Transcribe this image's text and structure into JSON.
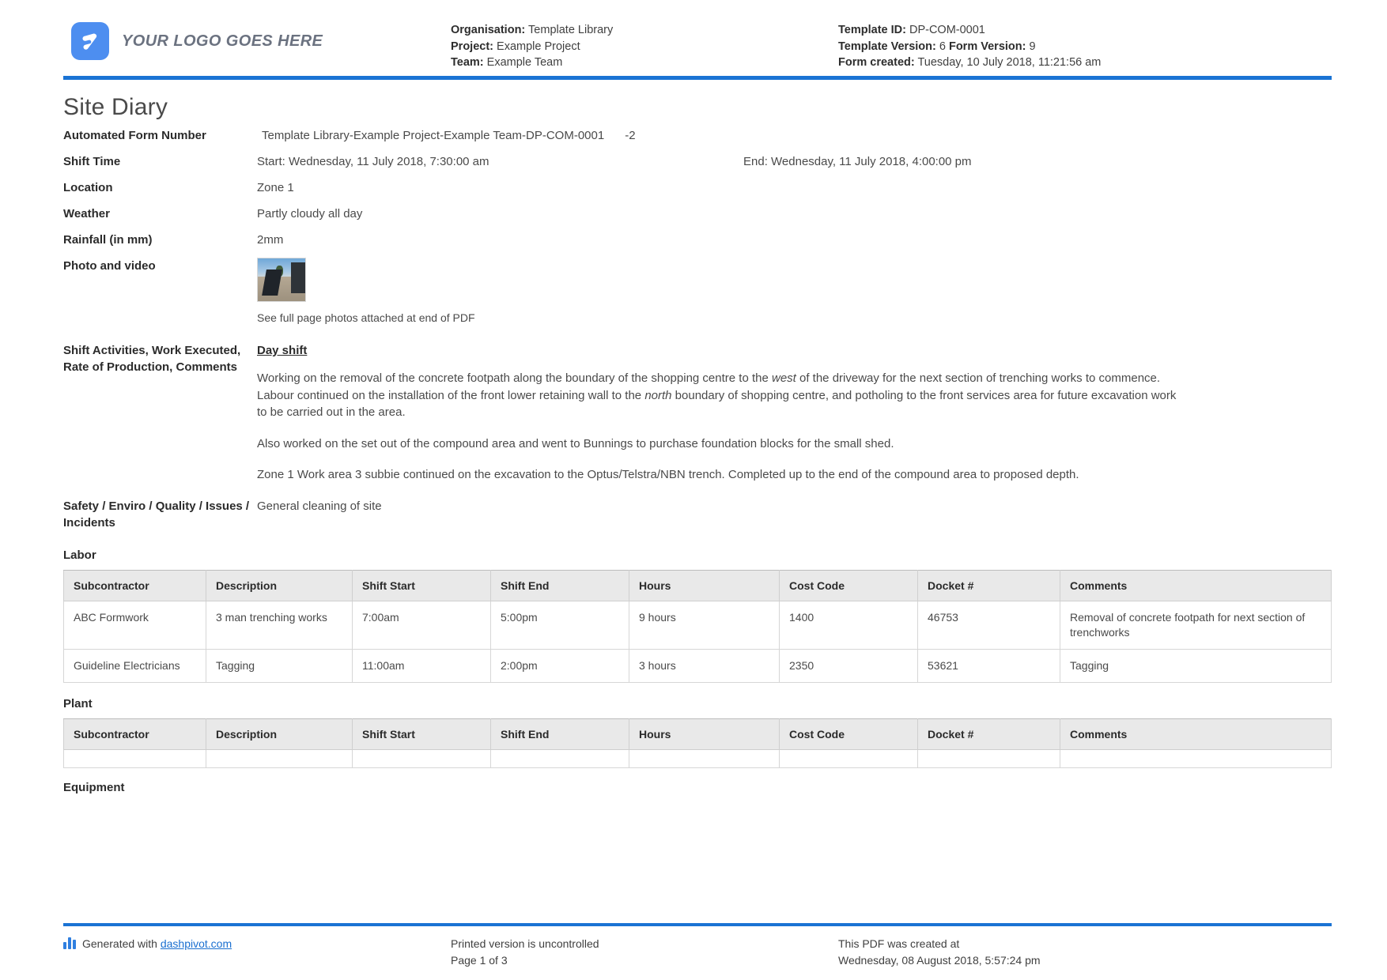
{
  "header": {
    "logo_text": "YOUR LOGO GOES HERE",
    "org_label": "Organisation:",
    "org_value": "Template Library",
    "project_label": "Project:",
    "project_value": "Example Project",
    "team_label": "Team:",
    "team_value": "Example Team",
    "template_id_label": "Template ID:",
    "template_id_value": "DP-COM-0001",
    "template_version_label": "Template Version:",
    "template_version_value": "6",
    "form_version_label": "Form Version:",
    "form_version_value": "9",
    "form_created_label": "Form created:",
    "form_created_value": "Tuesday, 10 July 2018, 11:21:56 am"
  },
  "title": "Site Diary",
  "fields": {
    "automated_form_number_label": "Automated Form Number",
    "automated_form_number_value": "Template Library-Example Project-Example Team-DP-COM-0001",
    "automated_form_number_suffix": "-2",
    "shift_time_label": "Shift Time",
    "shift_start": "Start: Wednesday, 11 July 2018, 7:30:00 am",
    "shift_end": "End: Wednesday, 11 July 2018, 4:00:00 pm",
    "location_label": "Location",
    "location_value": "Zone 1",
    "weather_label": "Weather",
    "weather_value": "Partly cloudy all day",
    "rainfall_label": "Rainfall (in mm)",
    "rainfall_value": "2mm",
    "photo_label": "Photo and video",
    "photo_caption": "See full page photos attached at end of PDF",
    "activities_label": "Shift Activities, Work Executed, Rate of Production, Comments",
    "activities_subheading": "Day shift",
    "activities_para1_a": "Working on the removal of the concrete footpath along the boundary of the shopping centre to the ",
    "activities_para1_i1": "west",
    "activities_para1_b": " of the driveway for the next section of trenching works to commence. Labour continued on the installation of the front lower retaining wall to the ",
    "activities_para1_i2": "north",
    "activities_para1_c": " boundary of shopping centre, and potholing to the front services area for future excavation work to be carried out in the area.",
    "activities_para2": "Also worked on the set out of the compound area and went to Bunnings to purchase foundation blocks for the small shed.",
    "activities_para3": "Zone 1 Work area 3 subbie continued on the excavation to the Optus/Telstra/NBN trench. Completed up to the end of the compound area to proposed depth.",
    "safety_label": "Safety / Enviro / Quality / Issues / Incidents",
    "safety_value": "General cleaning of site"
  },
  "tables": {
    "columns": [
      "Subcontractor",
      "Description",
      "Shift Start",
      "Shift End",
      "Hours",
      "Cost Code",
      "Docket #",
      "Comments"
    ],
    "labor": {
      "title": "Labor",
      "rows": [
        {
          "subcontractor": "ABC Formwork",
          "description": "3 man trenching works",
          "shift_start": "7:00am",
          "shift_end": "5:00pm",
          "hours": "9 hours",
          "cost_code": "1400",
          "docket": "46753",
          "comments": "Removal of concrete footpath for next section of trenchworks"
        },
        {
          "subcontractor": "Guideline Electricians",
          "description": "Tagging",
          "shift_start": "11:00am",
          "shift_end": "2:00pm",
          "hours": "3 hours",
          "cost_code": "2350",
          "docket": "53621",
          "comments": "Tagging"
        }
      ]
    },
    "plant": {
      "title": "Plant",
      "rows": []
    },
    "equipment": {
      "title": "Equipment"
    }
  },
  "footer": {
    "generated_prefix": "Generated with ",
    "generated_link": "dashpivot.com",
    "uncontrolled": "Printed version is uncontrolled",
    "page": "Page 1 of 3",
    "created_line1": "This PDF was created at",
    "created_line2": "Wednesday, 08 August 2018, 5:57:24 pm"
  }
}
